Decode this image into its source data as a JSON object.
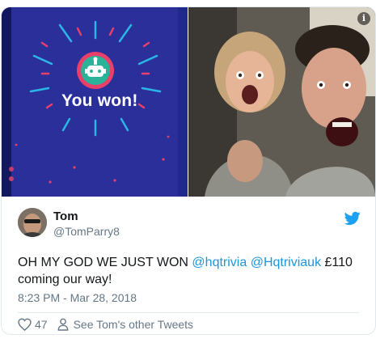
{
  "media": {
    "left_image_caption": "You won!",
    "info_icon": "info-icon"
  },
  "tweet": {
    "author_name": "Tom",
    "author_handle": "@TomParry8",
    "text_prefix": "OH MY GOD WE JUST WON ",
    "mention_1": "@hqtrivia",
    "mention_2": "@Hqtriviauk",
    "text_suffix": " £110 coming our way!",
    "timestamp": "8:23 PM - Mar 28, 2018",
    "like_count": "47",
    "other_tweets_link": "See Tom's other Tweets"
  },
  "colors": {
    "link": "#1b95e0",
    "secondary_text": "#657786",
    "hq_background": "#1f2a8c",
    "hq_badge": "#2bb39a",
    "hq_ring": "#e8406a"
  },
  "icons": [
    "twitter-bird-icon",
    "heart-icon",
    "person-icon",
    "info-icon",
    "hq-robot-icon"
  ]
}
